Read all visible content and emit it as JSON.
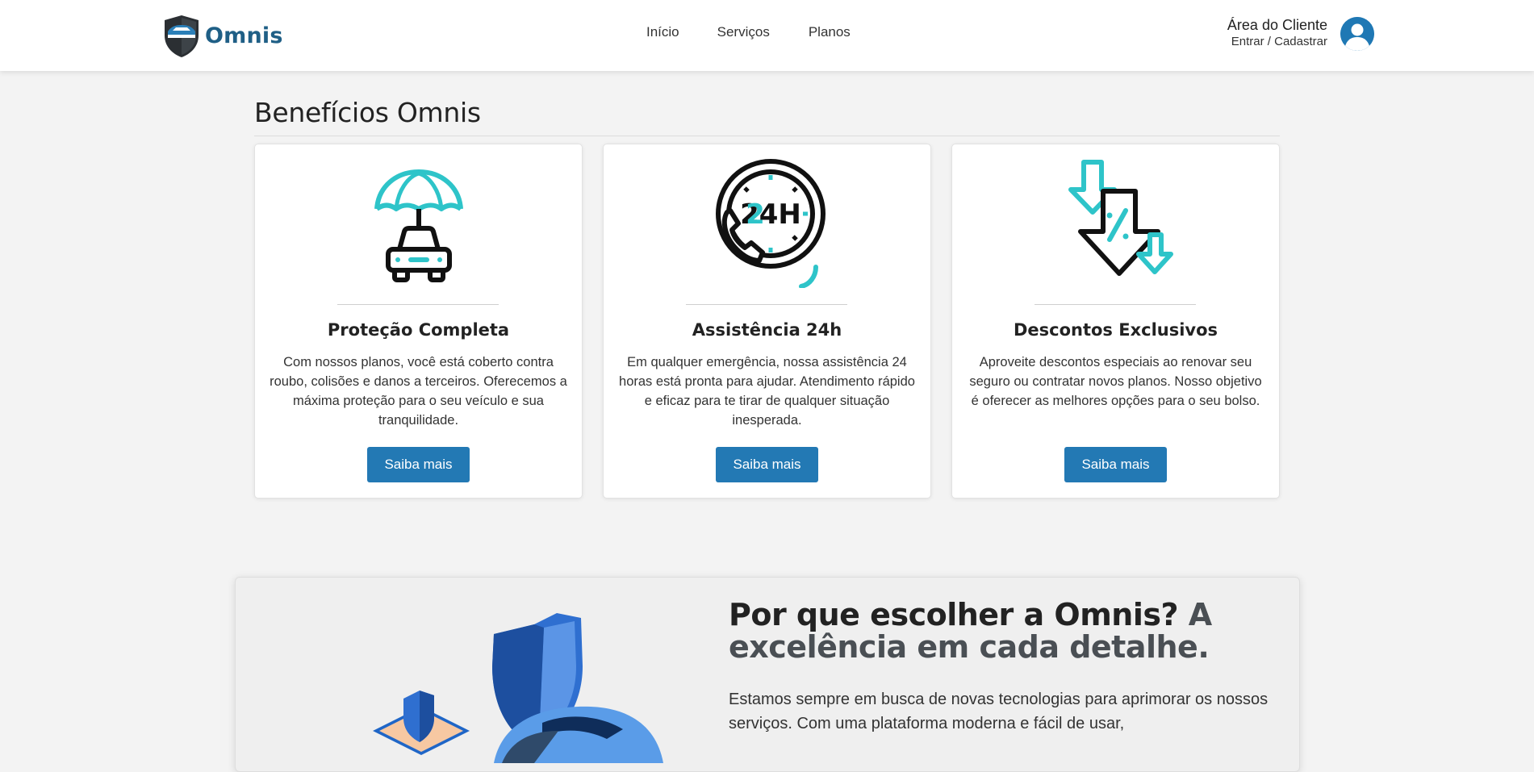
{
  "header": {
    "brand_name": "Omnis",
    "nav": [
      {
        "label": "Início"
      },
      {
        "label": "Serviços"
      },
      {
        "label": "Planos"
      }
    ],
    "client_area": {
      "title": "Área do Cliente",
      "subtitle": "Entrar / Cadastrar"
    }
  },
  "benefits": {
    "title": "Benefícios Omnis",
    "cards": [
      {
        "icon": "umbrella-car-icon",
        "title": "Proteção Completa",
        "text": "Com nossos planos, você está coberto contra roubo, colisões e danos a terceiros. Oferecemos a máxima proteção para o seu veículo e sua tranquilidade.",
        "button": "Saiba mais"
      },
      {
        "icon": "phone-24h-icon",
        "title": "Assistência 24h",
        "text": "Em qualquer emergência, nossa assistência 24 horas está pronta para ajudar. Atendimento rápido e eficaz para te tirar de qualquer situação inesperada.",
        "button": "Saiba mais"
      },
      {
        "icon": "discount-arrows-icon",
        "title": "Descontos Exclusivos",
        "text": "Aproveite descontos especiais ao renovar seu seguro ou contratar novos planos. Nosso objetivo é oferecer as melhores opções para o seu bolso.",
        "button": "Saiba mais"
      }
    ]
  },
  "why": {
    "heading_main": "Por que escolher a Omnis?",
    "heading_accent": "A excelência em cada detalhe.",
    "text": "Estamos sempre em busca de novas tecnologias para aprimorar os nossos serviços. Com uma plataforma moderna e fácil de usar,"
  },
  "colors": {
    "brand_blue": "#1f5f86",
    "button_blue": "#2379b4",
    "accent_teal": "#2ec4c9",
    "page_bg": "#f3f3f3"
  }
}
